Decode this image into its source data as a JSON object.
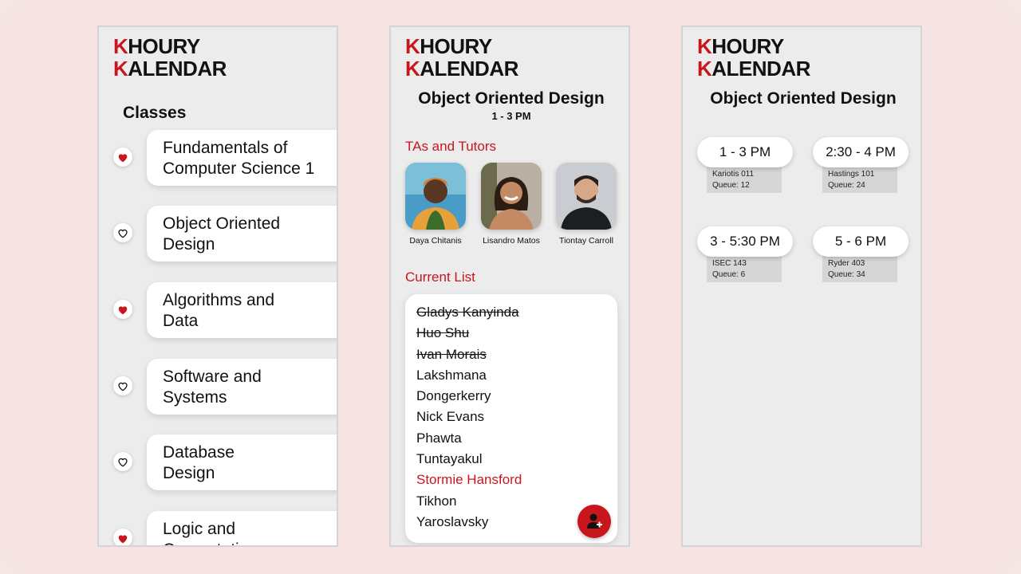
{
  "brand": {
    "line1_initial": "K",
    "line1_rest": "HOURY",
    "line2_initial": "K",
    "line2_rest": "ALENDAR",
    "accent": "#c8161d"
  },
  "classes_screen": {
    "heading": "Classes",
    "items": [
      {
        "line1": "Fundamentals of",
        "line2": "Computer Science 1",
        "favorited": true
      },
      {
        "line1": "Object Oriented",
        "line2": "Design",
        "favorited": false
      },
      {
        "line1": "Algorithms and",
        "line2": "Data",
        "favorited": true
      },
      {
        "line1": "Software and",
        "line2": "Systems",
        "favorited": false
      },
      {
        "line1": "Database",
        "line2": "Design",
        "favorited": false
      },
      {
        "line1": "Logic and",
        "line2": "Computation",
        "favorited": true
      }
    ]
  },
  "course_screen": {
    "title": "Object Oriented Design",
    "time": "1 - 3 PM",
    "tas_heading": "TAs and Tutors",
    "tas": [
      {
        "name": "Daya Chitanis"
      },
      {
        "name": "Lisandro Matos"
      },
      {
        "name": "Tiontay Carroll"
      }
    ],
    "list_heading": "Current List",
    "queue": [
      {
        "name": "Gladys Kanyinda",
        "state": "done"
      },
      {
        "name": "Huo Shu",
        "state": "done"
      },
      {
        "name": "Ivan Morais",
        "state": "done"
      },
      {
        "name": "Lakshmana",
        "state": "waiting"
      },
      {
        "name": "Dongerkerry",
        "state": "waiting"
      },
      {
        "name": "Nick Evans",
        "state": "waiting"
      },
      {
        "name": "Phawta",
        "state": "waiting"
      },
      {
        "name": "Tuntayakul",
        "state": "waiting"
      },
      {
        "name": "Stormie Hansford",
        "state": "current"
      },
      {
        "name": "Tikhon",
        "state": "waiting"
      },
      {
        "name": "Yaroslavsky",
        "state": "waiting"
      }
    ],
    "add_icon": "add-person-icon"
  },
  "hours_screen": {
    "title": "Object Oriented Design",
    "slots": [
      {
        "time": "1 - 3 PM",
        "location": "Kariotis 011",
        "queue": "Queue: 12"
      },
      {
        "time": "2:30 - 4 PM",
        "location": "Hastings 101",
        "queue": "Queue: 24"
      },
      {
        "time": "3 - 5:30 PM",
        "location": "ISEC 143",
        "queue": "Queue: 6"
      },
      {
        "time": "5 - 6 PM",
        "location": "Ryder 403",
        "queue": "Queue: 34"
      }
    ]
  }
}
